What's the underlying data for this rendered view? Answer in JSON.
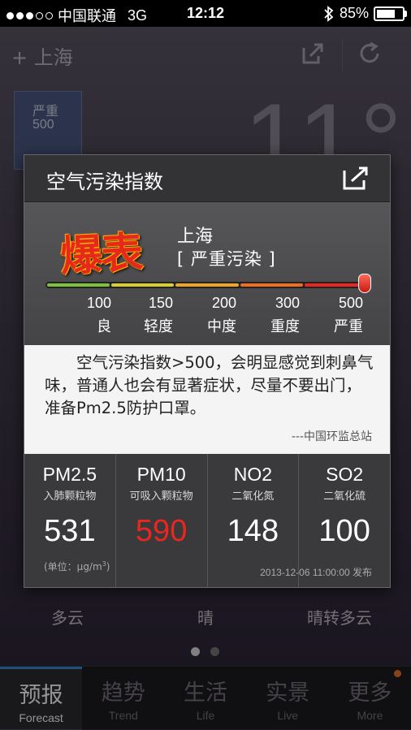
{
  "status_bar": {
    "carrier": "中国联通",
    "network": "3G",
    "time": "12:12",
    "battery": "85%",
    "battery_level": 0.85
  },
  "header": {
    "city": "上海"
  },
  "aqi_tile": {
    "level": "严重",
    "value": "500"
  },
  "weather": {
    "temperature": "11°"
  },
  "forecast": [
    "多云",
    "晴",
    "晴转多云"
  ],
  "dialog": {
    "title": "空气污染指数",
    "badge": "爆表",
    "city": "上海",
    "level": "[ 严重污染 ]",
    "scale_value": 500,
    "scale": [
      {
        "value": "100",
        "label": "良",
        "color": "#7cc23c"
      },
      {
        "value": "150",
        "label": "轻度",
        "color": "#d8cf2c"
      },
      {
        "value": "200",
        "label": "中度",
        "color": "#f0a52a"
      },
      {
        "value": "300",
        "label": "重度",
        "color": "#ef6d22"
      },
      {
        "value": "500",
        "label": "严重",
        "color": "#e8271e"
      }
    ],
    "description": "空气污染指数>500，会明显感觉到刺鼻气味，普通人也会有显著症状，尽量不要出门，准备Pm2.5防护口罩。",
    "source": "---中国环监总站",
    "pollutants": [
      {
        "code": "PM2.5",
        "name": "入肺颗粒物",
        "value": "531",
        "color": "#ffffff"
      },
      {
        "code": "PM10",
        "name": "可吸入颗粒物",
        "value": "590",
        "color": "#e8271e"
      },
      {
        "code": "NO2",
        "name": "二氧化氮",
        "value": "148",
        "color": "#ffffff"
      },
      {
        "code": "SO2",
        "name": "二氧化硫",
        "value": "100",
        "color": "#ffffff"
      }
    ],
    "unit": "(单位：μg/m",
    "unit_sup": "3",
    "unit_end": ")",
    "published": "2013-12-06 11:00:00 发布"
  },
  "tabs": [
    {
      "zh": "预报",
      "en": "Forecast"
    },
    {
      "zh": "趋势",
      "en": "Trend"
    },
    {
      "zh": "生活",
      "en": "Life"
    },
    {
      "zh": "实景",
      "en": "Live"
    },
    {
      "zh": "更多",
      "en": "More"
    }
  ]
}
